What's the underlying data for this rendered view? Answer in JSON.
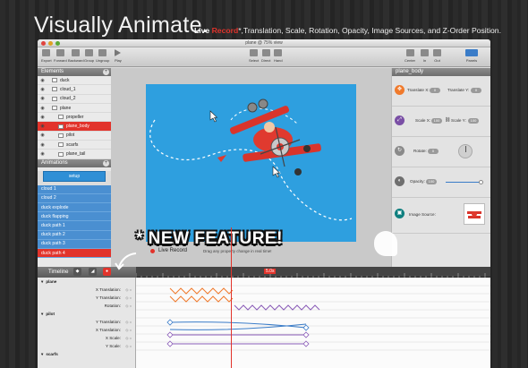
{
  "hero": {
    "title": "Visually Animate.",
    "subtitle_live": "Live ",
    "subtitle_record": "Record",
    "subtitle_rest": "*,Translation, Scale, Rotation, Opacity, Image Sources, and Z-Order Position."
  },
  "window": {
    "title": "plane @ 75% view",
    "toolbar": {
      "export": "Export",
      "forward": "Forward",
      "backward": "Backward",
      "group": "Group",
      "ungroup": "Ungroup",
      "play": "Play",
      "select": "Select",
      "direct": "Direct",
      "hand": "Hand",
      "center": "Center",
      "in": "In",
      "out": "Out",
      "panels": "Panels"
    }
  },
  "elements_panel": {
    "title": "Elements",
    "items": [
      {
        "label": "duck",
        "indent": 1
      },
      {
        "label": "cloud_1",
        "indent": 1
      },
      {
        "label": "cloud_2",
        "indent": 1
      },
      {
        "label": "plane",
        "indent": 1
      },
      {
        "label": "propeller",
        "indent": 2
      },
      {
        "label": "plane_body",
        "indent": 2,
        "selected": true
      },
      {
        "label": "pilot",
        "indent": 2
      },
      {
        "label": "scarfs",
        "indent": 2
      },
      {
        "label": "plane_tail",
        "indent": 2
      }
    ]
  },
  "animations_panel": {
    "title": "Animations",
    "setup_label": "setup",
    "items": [
      {
        "label": "cloud 1"
      },
      {
        "label": "cloud 2"
      },
      {
        "label": "duck explode"
      },
      {
        "label": "duck flapping"
      },
      {
        "label": "duck path 1"
      },
      {
        "label": "duck path 2"
      },
      {
        "label": "duck path 3"
      },
      {
        "label": "duck path 4",
        "selected": true
      }
    ]
  },
  "canvas": {
    "live_record_label": "Live Record",
    "live_record_hint": "Drag any property change in real time!"
  },
  "inspector": {
    "title": "plane_body",
    "translate_x_label": "Translate X:",
    "translate_x_value": "0",
    "translate_y_label": "Translate Y:",
    "translate_y_value": "0",
    "scale_x_label": "Scale X:",
    "scale_x_value": "100",
    "scale_y_label": "Scale Y:",
    "scale_y_value": "100",
    "rotate_label": "Rotate:",
    "rotate_value": "0",
    "opacity_label": "Opacity:",
    "opacity_value": "100",
    "opacity_level": 1.0,
    "image_source_label": "Image Source:"
  },
  "feature_banner": "* NEW FEATURE!",
  "timeline": {
    "title": "Timeline",
    "btn_labels": [
      "Ease in",
      "Ease out",
      "Record"
    ],
    "ruler_marks": [
      "5.0s"
    ],
    "groups": [
      {
        "label": "plane",
        "rows": [
          "X Translation:",
          "Y Translation:",
          "Rotation:"
        ]
      },
      {
        "label": "pilot",
        "rows": [
          "Y Translation:",
          "X Translation:",
          "X Scale:",
          "Y Scale:"
        ]
      },
      {
        "label": "scarfs",
        "rows": []
      }
    ]
  },
  "colors": {
    "accent_red": "#e2332b",
    "stage_blue": "#2e9fdf",
    "translate_badge": "#f07a2c",
    "scale_badge": "#7a4fa5",
    "rotate_badge": "#8a8a8a",
    "opacity_badge": "#6f6f6f",
    "image_badge": "#0f7f7f"
  }
}
